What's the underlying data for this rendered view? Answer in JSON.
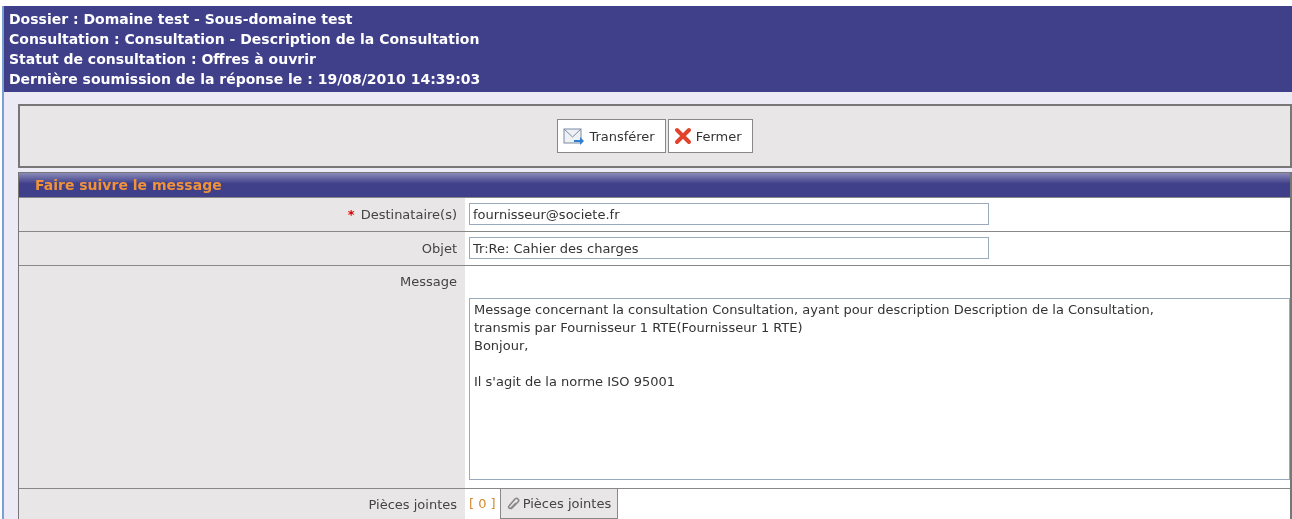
{
  "header": {
    "lines": [
      "Dossier : Domaine test - Sous-domaine test",
      "Consultation : Consultation - Description de la Consultation",
      "Statut de consultation : Offres à ouvrir",
      "Dernière soumission de la réponse le : 19/08/2010 14:39:03"
    ]
  },
  "toolbar": {
    "buttons": [
      {
        "label": "Transférer",
        "kind": "forward"
      },
      {
        "label": "Fermer",
        "kind": "close"
      }
    ]
  },
  "section": {
    "title": "Faire suivre le message"
  },
  "fields": [
    {
      "label": "Destinataire(s)",
      "marker": "*",
      "kind": "input",
      "value": "fournisseur@societe.fr"
    },
    {
      "label": "Objet",
      "kind": "input",
      "value": "Tr:Re: Cahier des charges"
    },
    {
      "label": "Message",
      "kind": "textarea",
      "value": "Message concernant la consultation Consultation, ayant pour description Description de la Consultation,\ntransmis par Fournisseur 1 RTE(Fournisseur 1 RTE)\nBonjour,\n\nIl s'agit de la norme ISO 95001"
    },
    {
      "label": "Pièces jointes",
      "kind": "attachments",
      "count": "[ 0 ]",
      "button": "Pièces jointes"
    }
  ]
}
